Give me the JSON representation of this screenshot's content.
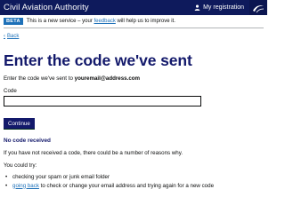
{
  "header": {
    "brand": "Civil Aviation Authority",
    "account_label": "My registration"
  },
  "phase_banner": {
    "tag": "BETA",
    "text_before": "This is a new service – your",
    "link": "feedback",
    "text_after": "will help us to improve it."
  },
  "back_link": "Back",
  "page": {
    "title": "Enter the code we've sent",
    "intro_prefix": "Enter the code we've sent to",
    "email": "youremail@address.com",
    "code_label": "Code",
    "code_value": "",
    "continue_label": "Continue",
    "no_code_heading": "No code received",
    "no_code_text": "If you have not received a code, there could be a number of reasons why.",
    "you_could_try": "You could try:",
    "tips": {
      "spam": "checking your spam or junk email folder",
      "going_back_link": "going back",
      "going_back_rest": "to check or change your email address and trying again for a new code"
    }
  },
  "colors": {
    "header_bg": "#0e1a5c",
    "title": "#13196b",
    "link": "#1d70b8",
    "button_bg": "#13196b",
    "beta_tag": "#1d70b8"
  },
  "icons": {
    "account": "person-icon",
    "logo": "caa-logo-icon",
    "back": "chevron-left-icon"
  }
}
